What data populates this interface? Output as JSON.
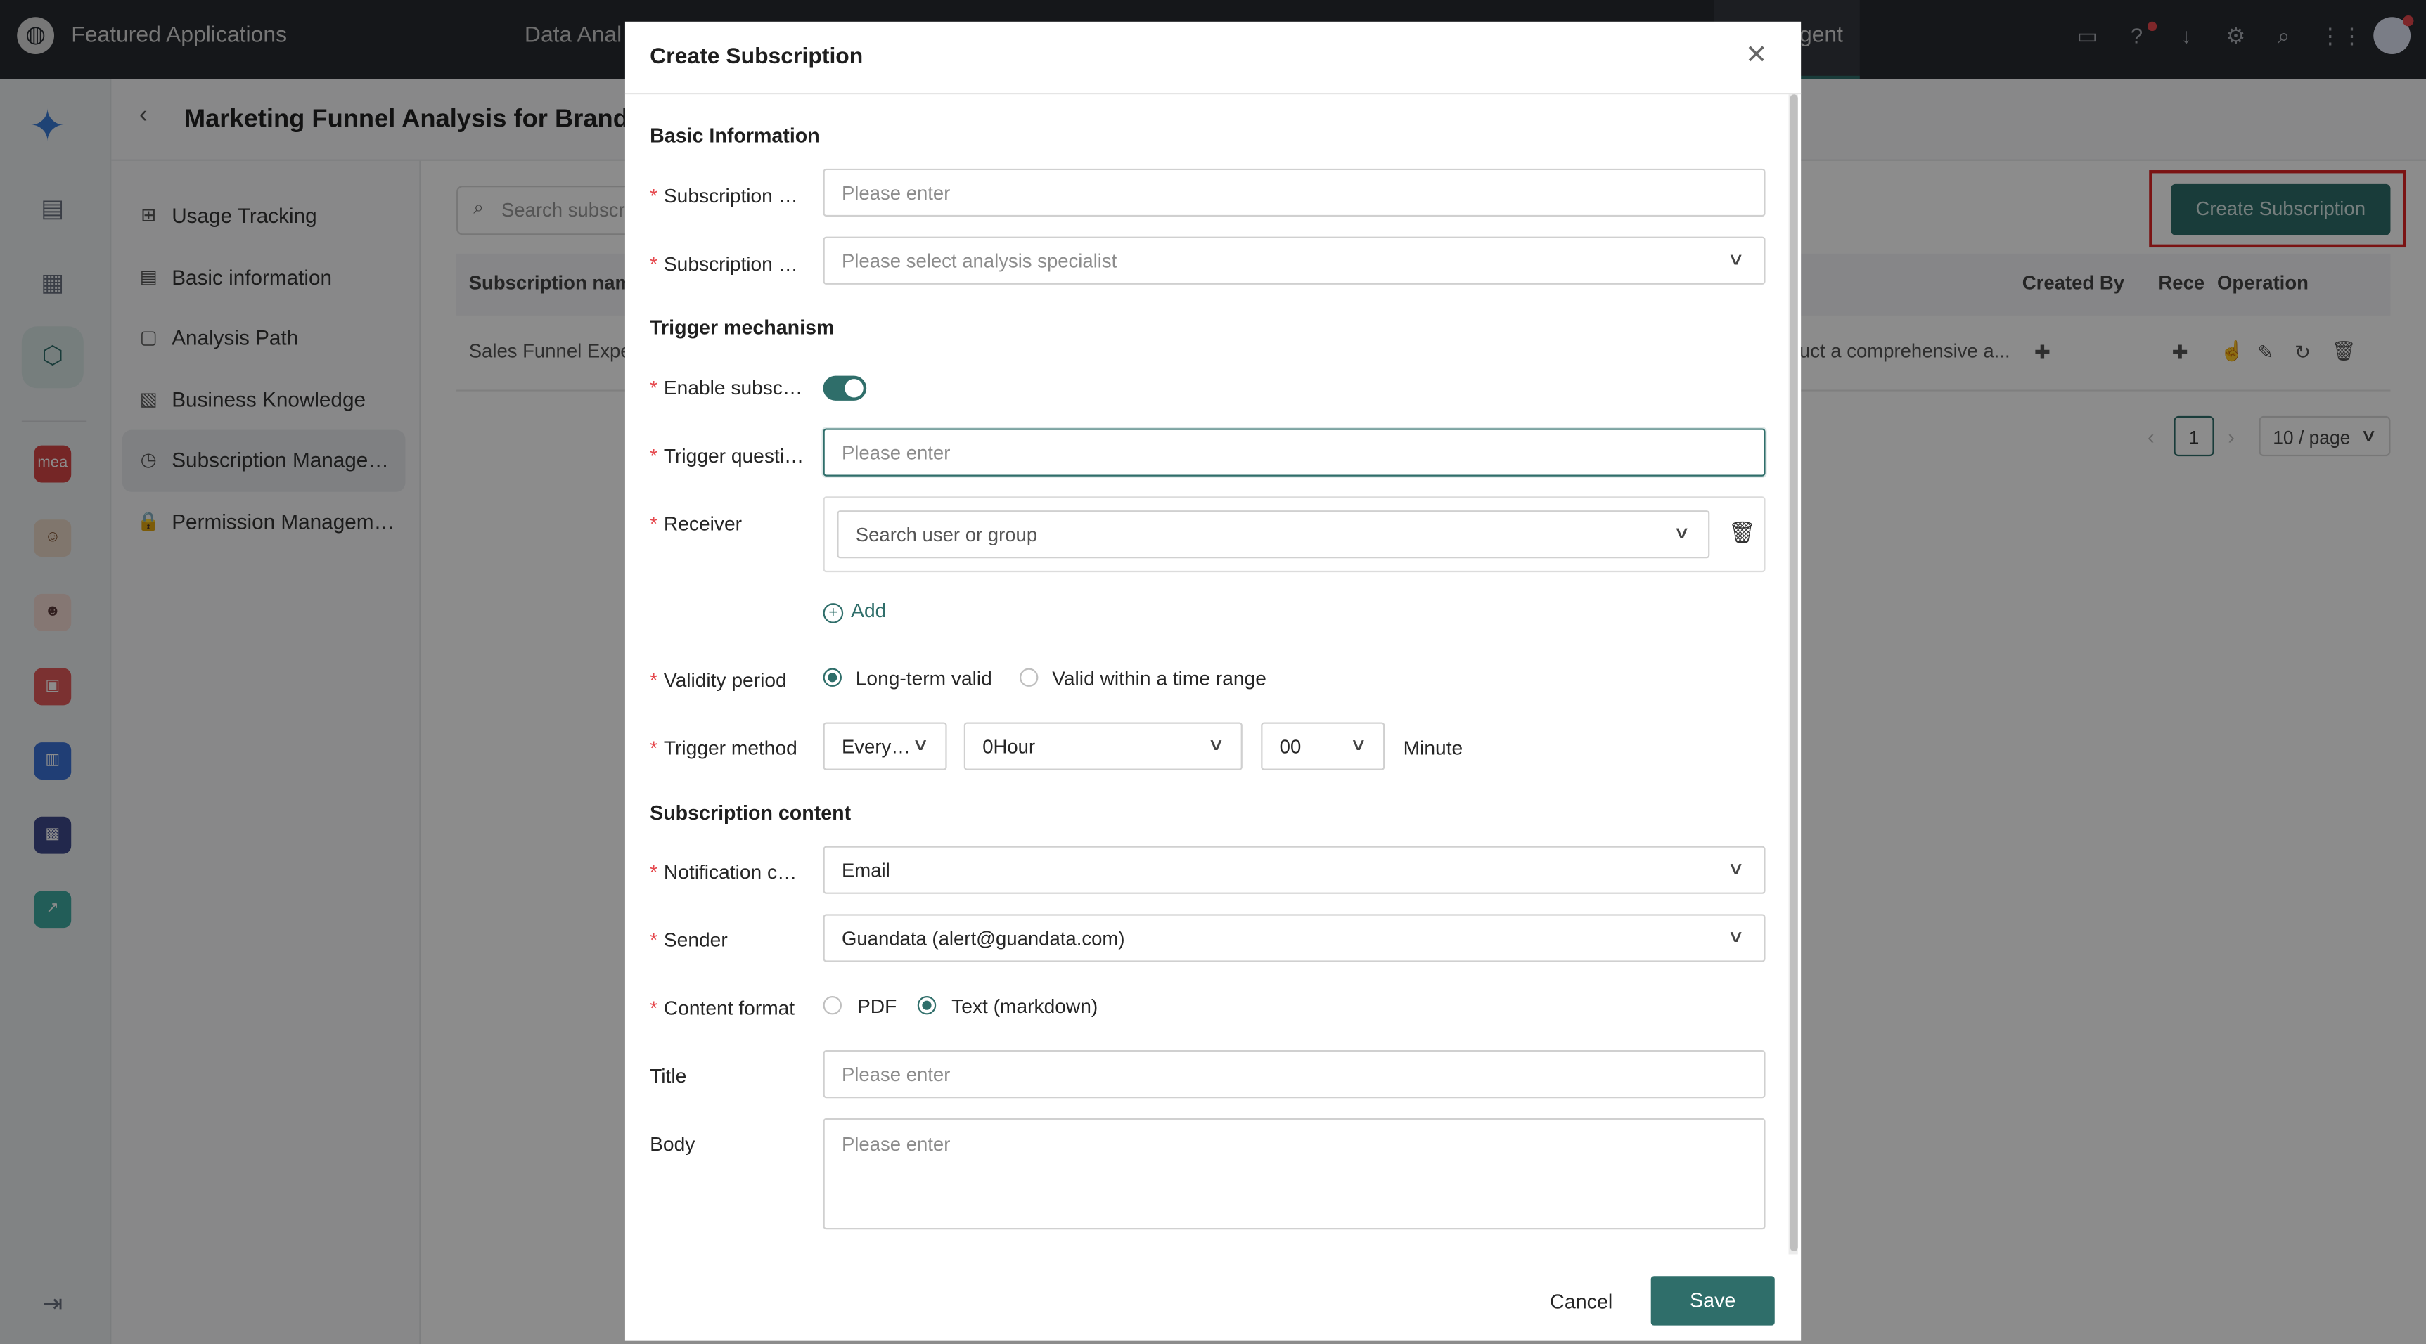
{
  "topbar": {
    "app_title": "Featured Applications",
    "tab_data": "Data Anal",
    "tab_agent": "gent",
    "icons": [
      "monitor-icon",
      "help-icon",
      "download-icon",
      "settings-icon",
      "search-icon",
      "apps-grid-icon",
      "avatar"
    ]
  },
  "rail": {
    "app_badge_text": "mea"
  },
  "page": {
    "back_glyph": "‹",
    "title": "Marketing Funnel Analysis for Brande"
  },
  "subnav": {
    "items": [
      {
        "label": "Usage Tracking",
        "icon": "tracking-icon"
      },
      {
        "label": "Basic information",
        "icon": "info-doc-icon"
      },
      {
        "label": "Analysis Path",
        "icon": "ai-path-icon"
      },
      {
        "label": "Business Knowledge",
        "icon": "knowledge-icon"
      },
      {
        "label": "Subscription Manage…",
        "icon": "subscription-icon"
      },
      {
        "label": "Permission Managem…",
        "icon": "lock-icon"
      }
    ]
  },
  "content": {
    "search_placeholder": "Search subscr",
    "create_button": "Create Subscription",
    "columns": {
      "name": "Subscription nam",
      "created_by": "Created By",
      "receiver": "Rece",
      "operation": "Operation"
    },
    "row": {
      "name": "Sales Funnel Expe",
      "description": "uct a comprehensive a..."
    },
    "pager": {
      "current": "1",
      "page_size": "10 / page"
    }
  },
  "modal": {
    "title": "Create Subscription",
    "sections": {
      "basic": "Basic Information",
      "trigger": "Trigger mechanism",
      "content": "Subscription content"
    },
    "labels": {
      "subscription_name": "Subscription …",
      "subscription_specialist": "Subscription …",
      "enable": "Enable subsc…",
      "trigger_question": "Trigger questi…",
      "receiver": "Receiver",
      "validity": "Validity period",
      "trigger_method": "Trigger method",
      "notification": "Notification c…",
      "sender": "Sender",
      "content_format": "Content format",
      "title": "Title",
      "body": "Body"
    },
    "placeholders": {
      "name": "Please enter",
      "specialist": "Please select analysis specialist",
      "trigger_question": "Please enter",
      "receiver": "Search user or group",
      "title": "Please enter",
      "body": "Please enter"
    },
    "enable_toggle_on": true,
    "add_link": "Add",
    "validity": {
      "long_term": "Long-term valid",
      "time_range": "Valid within a time range",
      "selected": "long_term"
    },
    "trigger_method": {
      "frequency": "Every…",
      "hour": "0Hour",
      "minute_value": "00",
      "minute_label": "Minute"
    },
    "notification_value": "Email",
    "sender_value": "Guandata (alert@guandata.com)",
    "format": {
      "pdf": "PDF",
      "text": "Text (markdown)",
      "selected": "text"
    },
    "buttons": {
      "cancel": "Cancel",
      "save": "Save"
    }
  },
  "colors": {
    "primary": "#2f6e6a",
    "topbar": "#272a30",
    "highlight": "#e02424",
    "required": "#e5484d"
  }
}
